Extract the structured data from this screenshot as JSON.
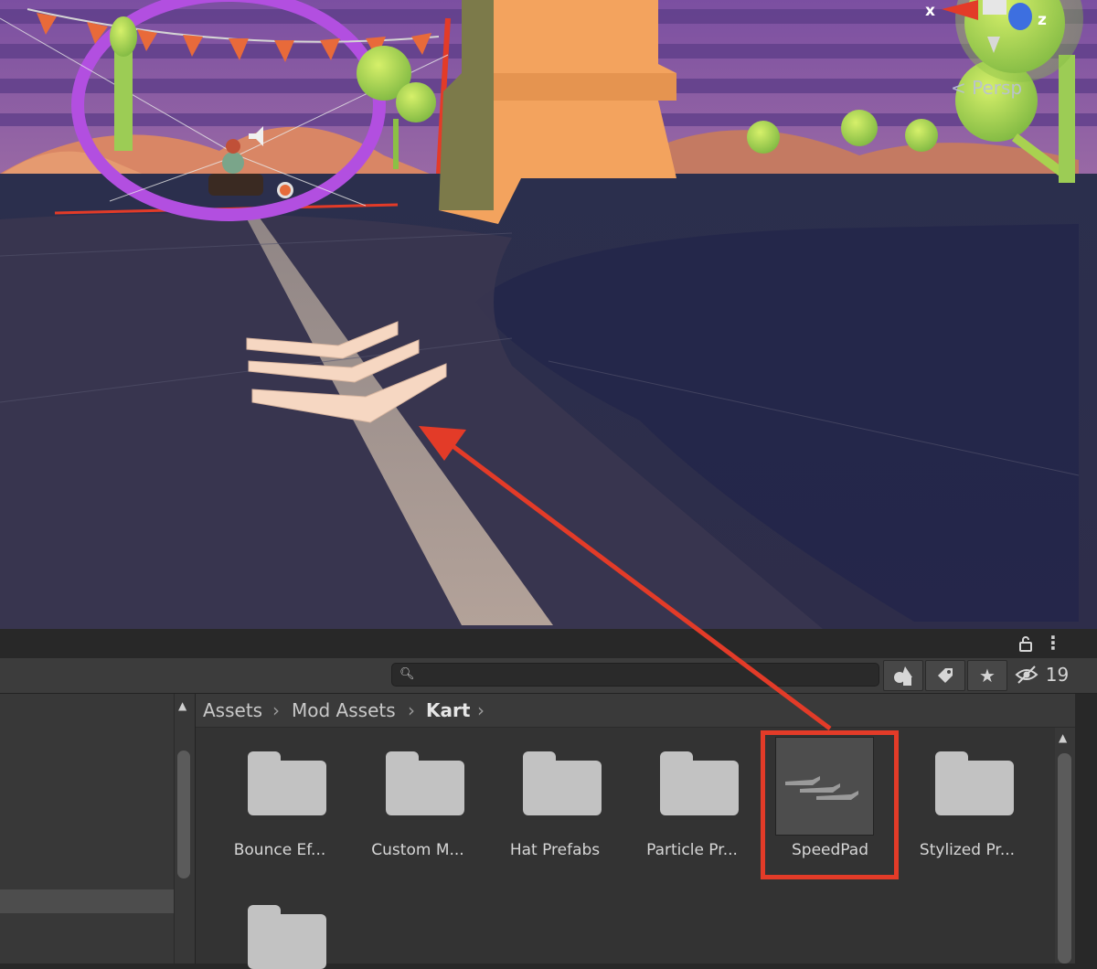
{
  "scene": {
    "axis_x_label": "x",
    "axis_z_label": "z",
    "perspective_label": "< Persp"
  },
  "panel": {
    "lock_icon": "lock-icon",
    "more_icon": "more-options-icon"
  },
  "toolbar": {
    "search_placeholder": "",
    "hidden_count": "19",
    "buttons": [
      "search-by-type-icon",
      "search-by-label-icon",
      "favorites-star-icon",
      "hidden-packages-eye-icon"
    ]
  },
  "breadcrumb": {
    "items": [
      "Assets",
      "Mod Assets",
      "Kart"
    ]
  },
  "grid": {
    "tiles": [
      {
        "label": "Bounce Ef...",
        "kind": "folder"
      },
      {
        "label": "Custom M...",
        "kind": "folder"
      },
      {
        "label": "Hat Prefabs",
        "kind": "folder"
      },
      {
        "label": "Particle Pr...",
        "kind": "folder"
      },
      {
        "label": "SpeedPad",
        "kind": "prefab"
      },
      {
        "label": "Stylized Pr...",
        "kind": "folder"
      },
      {
        "label": "",
        "kind": "folder"
      }
    ]
  },
  "annotation": {
    "highlight_color": "#e33b28"
  }
}
